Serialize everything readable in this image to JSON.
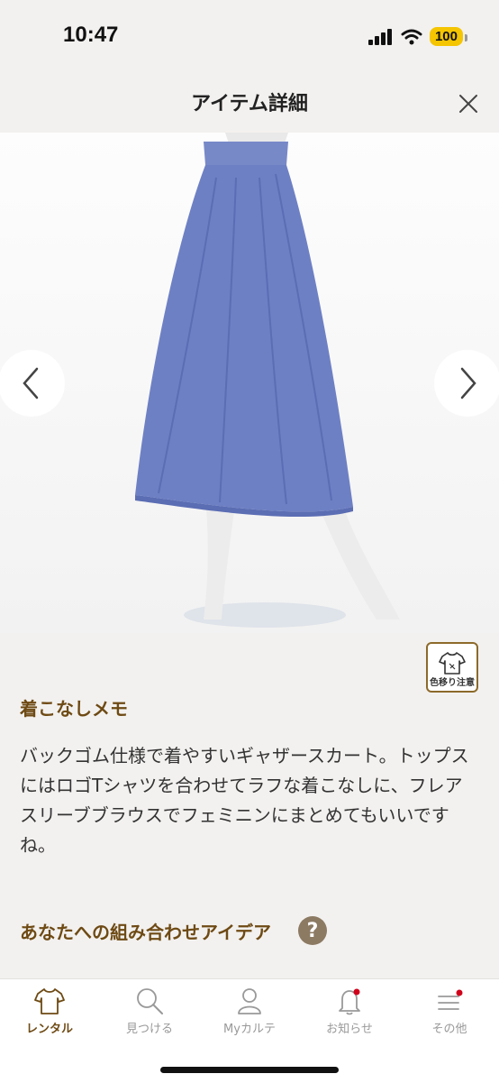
{
  "status": {
    "time": "10:47",
    "battery": "100"
  },
  "header": {
    "title": "アイテム詳細"
  },
  "badge": {
    "label": "色移り注意"
  },
  "memo": {
    "title": "着こなしメモ",
    "body": "バックゴム仕様で着やすいギャザースカート。トップスにはロゴTシャツを合わせてラフな着こなしに、フレアスリーブブラウスでフェミニンにまとめてもいいですね。"
  },
  "ideas": {
    "title": "あなたへの組み合わせアイデア",
    "help": "?"
  },
  "tabs": [
    {
      "label": "レンタル",
      "icon": "tshirt-icon",
      "active": true
    },
    {
      "label": "見つける",
      "icon": "search-icon",
      "active": false
    },
    {
      "label": "Myカルテ",
      "icon": "person-icon",
      "active": false
    },
    {
      "label": "お知らせ",
      "icon": "bell-icon",
      "active": false
    },
    {
      "label": "その他",
      "icon": "menu-icon",
      "active": false
    }
  ],
  "colors": {
    "accent": "#6e4a14",
    "skirt": "#6e80c4",
    "badge_border": "#8c6a2a",
    "notify_dot": "#d0021b"
  }
}
